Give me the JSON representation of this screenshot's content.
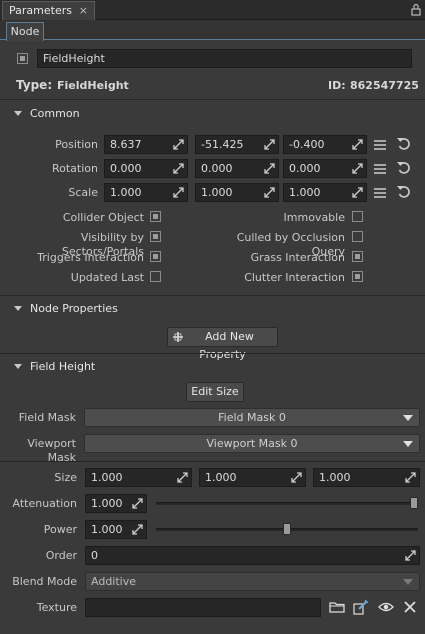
{
  "window": {
    "tab_title": "Parameters",
    "tab_close": "×"
  },
  "tabs": {
    "node": "Node"
  },
  "node": {
    "name": "FieldHeight",
    "type_label": "Type:",
    "type_value": "FieldHeight",
    "id_label": "ID:",
    "id_value": "862547725"
  },
  "common": {
    "title": "Common",
    "position": {
      "label": "Position",
      "x": "8.637",
      "y": "-51.425",
      "z": "-0.400"
    },
    "rotation": {
      "label": "Rotation",
      "x": "0.000",
      "y": "0.000",
      "z": "0.000"
    },
    "scale": {
      "label": "Scale",
      "x": "1.000",
      "y": "1.000",
      "z": "1.000"
    },
    "flags": {
      "collider_object": {
        "label": "Collider Object",
        "checked": true
      },
      "immovable": {
        "label": "Immovable",
        "checked": false
      },
      "visibility_sectors": {
        "label": "Visibility by Sectors/Portals",
        "checked": true
      },
      "culled_occlusion": {
        "label": "Culled by Occlusion Query",
        "checked": false
      },
      "triggers_interaction": {
        "label": "Triggers Interaction",
        "checked": true
      },
      "grass_interaction": {
        "label": "Grass Interaction",
        "checked": true
      },
      "updated_last": {
        "label": "Updated Last",
        "checked": false
      },
      "clutter_interaction": {
        "label": "Clutter Interaction",
        "checked": true
      }
    }
  },
  "node_properties": {
    "title": "Node Properties",
    "add_button": "Add New Property"
  },
  "field_height": {
    "title": "Field Height",
    "edit_size_button": "Edit Size",
    "field_mask": {
      "label": "Field Mask",
      "value": "Field Mask 0"
    },
    "viewport_mask": {
      "label": "Viewport Mask",
      "value": "Viewport Mask 0"
    },
    "size": {
      "label": "Size",
      "x": "1.000",
      "y": "1.000",
      "z": "1.000"
    },
    "attenuation": {
      "label": "Attenuation",
      "value": "1.000",
      "slider_fraction": 1.0
    },
    "power": {
      "label": "Power",
      "value": "1.000",
      "slider_fraction": 0.5
    },
    "order": {
      "label": "Order",
      "value": "0"
    },
    "blend_mode": {
      "label": "Blend Mode",
      "value": "Additive"
    },
    "texture": {
      "label": "Texture",
      "value": ""
    }
  },
  "icons": [
    "lock-icon",
    "drag-arrows-icon",
    "menu-icon",
    "reset-icon",
    "plus-icon",
    "folder-icon",
    "edit-icon",
    "eye-icon",
    "close-icon"
  ],
  "colors": {
    "accent": "#5c7e99",
    "panel": "#3a3a3a",
    "field": "#262626"
  }
}
